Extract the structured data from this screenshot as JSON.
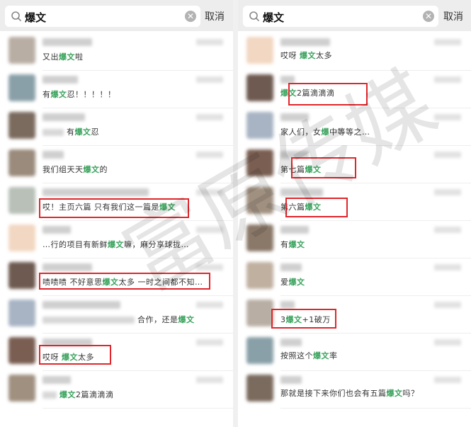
{
  "left": {
    "search": {
      "query": "爆文",
      "cancel_label": "取消"
    },
    "rows": [
      {
        "prefix": "",
        "before": "又出",
        "hl": "爆文",
        "after": "啦"
      },
      {
        "prefix": "",
        "before": "有",
        "hl": "爆文",
        "after": "忍！！！！！"
      },
      {
        "prefix": "",
        "before": "有",
        "hl": "爆文",
        "after": "忍"
      },
      {
        "prefix": "",
        "before": "我们组天天",
        "hl": "爆文",
        "after": "的"
      },
      {
        "prefix": "",
        "before": "哎！主页六篇 只有我们这一篇是",
        "hl": "爆文",
        "after": ""
      },
      {
        "prefix": "",
        "before": "…行的项目有新鲜",
        "hl": "爆文",
        "after": "嘛，麻分享球拢…"
      },
      {
        "prefix": "",
        "before": "啧啧啧 不好意思",
        "hl": "爆文",
        "after": "太多 一时之间都不知…"
      },
      {
        "prefix": "",
        "before": "合作，还是",
        "hl": "爆文",
        "after": ""
      },
      {
        "prefix": "",
        "before": "哎呀 ",
        "hl": "爆文",
        "after": "太多"
      },
      {
        "prefix": "",
        "before": "",
        "hl": "爆文",
        "after": "2篇滴滴滴"
      }
    ]
  },
  "right": {
    "search": {
      "query": "爆文",
      "cancel_label": "取消"
    },
    "rows": [
      {
        "before": "哎呀 ",
        "hl": "爆文",
        "after": "太多"
      },
      {
        "before": "",
        "hl": "爆文",
        "after": "2篇滴滴滴"
      },
      {
        "before": "家人们，女",
        "hl": "爆",
        "after": "中等等之…"
      },
      {
        "before": "第七篇",
        "hl": "爆文",
        "after": ""
      },
      {
        "before": "第六篇",
        "hl": "爆文",
        "after": ""
      },
      {
        "before": "有",
        "hl": "爆文",
        "after": ""
      },
      {
        "before": "爱",
        "hl": "爆文",
        "after": ""
      },
      {
        "before": "3",
        "hl": "爆文",
        "after": "+1破万"
      },
      {
        "before": "按照这个",
        "hl": "爆文",
        "after": "率"
      },
      {
        "before": "那就是接下来你们也会有五篇",
        "hl": "爆文",
        "after": "吗？"
      }
    ]
  },
  "watermark": "富原传媒",
  "colors": {
    "highlight": "#3aa35d",
    "annotation_box": "#e0262b"
  }
}
